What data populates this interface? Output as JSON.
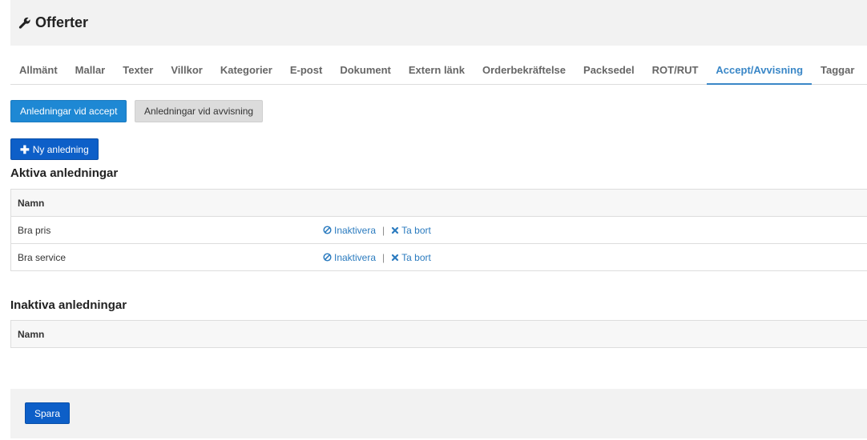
{
  "header": {
    "title": "Offerter",
    "icon": "wrench-icon"
  },
  "tabs": [
    {
      "label": "Allmänt"
    },
    {
      "label": "Mallar"
    },
    {
      "label": "Texter"
    },
    {
      "label": "Villkor"
    },
    {
      "label": "Kategorier"
    },
    {
      "label": "E-post"
    },
    {
      "label": "Dokument"
    },
    {
      "label": "Extern länk"
    },
    {
      "label": "Orderbekräftelse"
    },
    {
      "label": "Packsedel"
    },
    {
      "label": "ROT/RUT"
    },
    {
      "label": "Accept/Avvisning"
    },
    {
      "label": "Taggar"
    }
  ],
  "active_tab": "Accept/Avvisning",
  "segments": {
    "accept_label": "Anledningar vid accept",
    "reject_label": "Anledningar vid avvisning"
  },
  "new_button": {
    "label": "Ny anledning"
  },
  "active_section": {
    "title": "Aktiva anledningar",
    "column_header": "Namn",
    "rows": [
      {
        "name": "Bra pris",
        "deactivate": "Inaktivera",
        "delete": "Ta bort"
      },
      {
        "name": "Bra service",
        "deactivate": "Inaktivera",
        "delete": "Ta bort"
      }
    ]
  },
  "inactive_section": {
    "title": "Inaktiva anledningar",
    "column_header": "Namn"
  },
  "footer": {
    "save_label": "Spara"
  },
  "colors": {
    "accent": "#3a87c7",
    "primary_button": "#0d5fc8",
    "segment_active": "#1e88d4",
    "link": "#2b7bbf"
  }
}
